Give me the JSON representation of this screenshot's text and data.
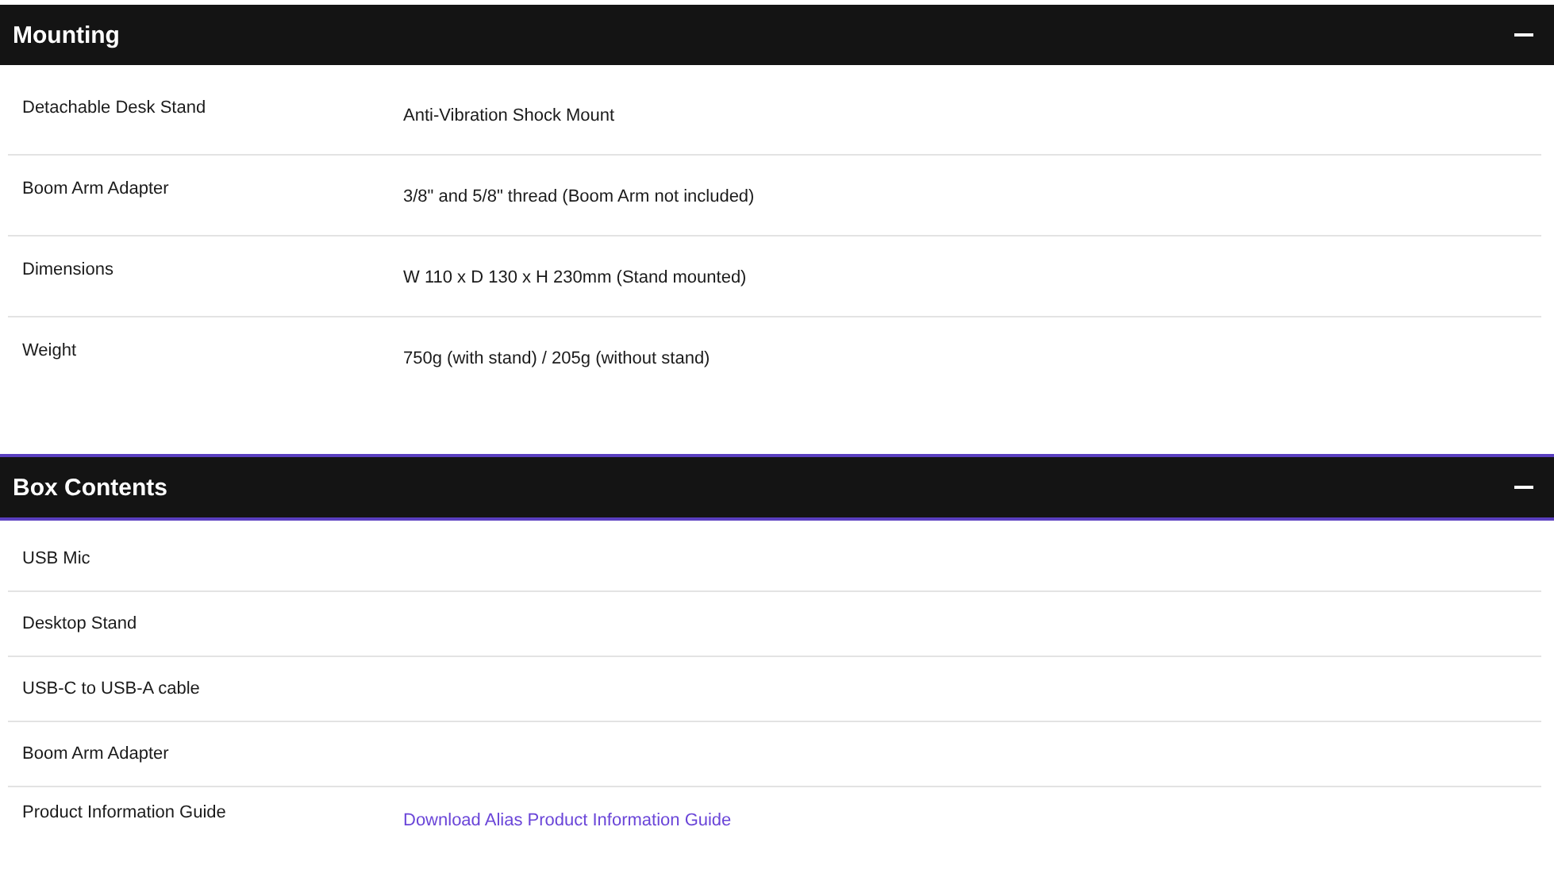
{
  "sections": [
    {
      "title": "Mounting",
      "expanded": true,
      "focused": false,
      "rows": [
        {
          "label": "Detachable Desk Stand",
          "value": {
            "text": "Anti-Vibration Shock Mount",
            "kind": "text"
          }
        },
        {
          "label": "Boom Arm Adapter",
          "value": {
            "text": "3/8\" and 5/8\" thread (Boom Arm not included)",
            "kind": "text"
          }
        },
        {
          "label": "Dimensions",
          "value": {
            "text": "W 110 x D 130 x H 230mm (Stand mounted)",
            "kind": "text"
          }
        },
        {
          "label": "Weight",
          "value": {
            "text": "750g (with stand) / 205g (without stand)",
            "kind": "text"
          }
        }
      ]
    },
    {
      "title": "Box Contents",
      "expanded": true,
      "focused": true,
      "rows": [
        {
          "label": "USB Mic"
        },
        {
          "label": "Desktop Stand"
        },
        {
          "label": "USB-C to USB-A cable"
        },
        {
          "label": "Boom Arm Adapter"
        },
        {
          "label": "Product Information Guide",
          "value": {
            "text": "Download Alias Product Information Guide",
            "kind": "link"
          }
        }
      ]
    }
  ]
}
